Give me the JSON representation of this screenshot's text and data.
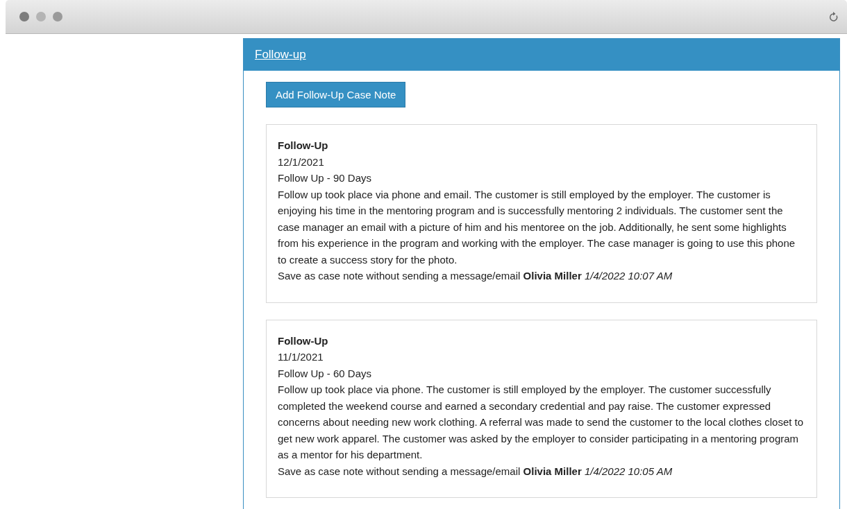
{
  "panel": {
    "title": "Follow-up",
    "add_button": "Add Follow-Up Case Note"
  },
  "notes": [
    {
      "type": "Follow-Up",
      "date": "12/1/2021",
      "period": "Follow Up - 90 Days",
      "body": "Follow up took place via phone and email. The customer is still employed by the employer. The customer is enjoying his time in the mentoring program and is successfully mentoring 2 individuals. The customer sent the case manager an email with a picture of him and his mentoree on the job. Additionally, he sent some highlights from his experience in the program and working with the employer. The case manager is going to use this phone to create a success story for the photo.",
      "footer": "Save as case note without sending a message/email **Olivia Miller** *1/4/2022 10:07 AM*"
    },
    {
      "type": "Follow-Up",
      "date": "11/1/2021",
      "period": "Follow Up - 60 Days",
      "body": "Follow up took place via phone. The customer is still employed by the employer. The customer successfully completed the weekend course and earned a secondary credential and pay raise. The customer expressed concerns about needing new work clothing. A referral was made to send the customer to the local clothes closet to get new work apparel. The customer was asked by the employer to consider participating in a mentoring program as a mentor for his department.",
      "footer": "Save as case note without sending a message/email **Olivia Miller** *1/4/2022 10:05 AM*"
    }
  ]
}
